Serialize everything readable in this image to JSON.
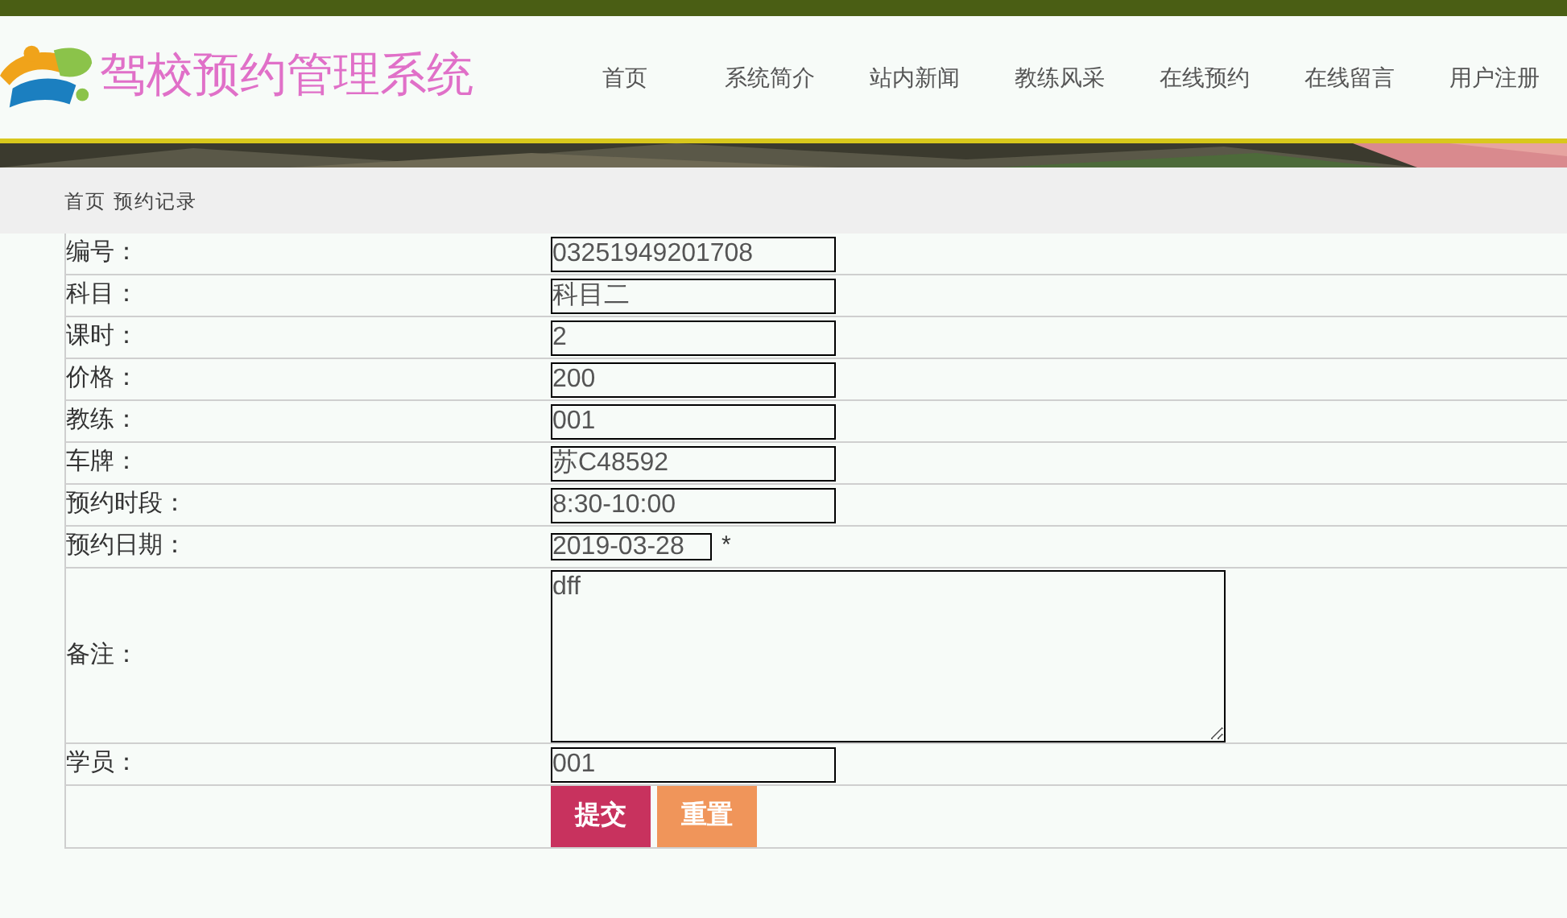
{
  "header": {
    "title": "驾校预约管理系统"
  },
  "nav": [
    {
      "label": "首页"
    },
    {
      "label": "系统简介"
    },
    {
      "label": "站内新闻"
    },
    {
      "label": "教练风采"
    },
    {
      "label": "在线预约"
    },
    {
      "label": "在线留言"
    },
    {
      "label": "用户注册"
    }
  ],
  "breadcrumb": "首页 预约记录",
  "form": {
    "fields": [
      {
        "kind": "input",
        "label": "编号：",
        "value": "03251949201708"
      },
      {
        "kind": "input",
        "label": "科目：",
        "value": "科目二"
      },
      {
        "kind": "input",
        "label": "课时：",
        "value": "2"
      },
      {
        "kind": "input",
        "label": "价格：",
        "value": "200"
      },
      {
        "kind": "input",
        "label": "教练：",
        "value": "001"
      },
      {
        "kind": "input",
        "label": "车牌：",
        "value": "苏C48592"
      },
      {
        "kind": "input",
        "label": "预约时段：",
        "value": "8:30-10:00"
      },
      {
        "kind": "date",
        "label": "预约日期：",
        "value": "2019-03-28",
        "required_mark": "*"
      },
      {
        "kind": "textarea",
        "label": "备注：",
        "value": "dff"
      },
      {
        "kind": "input",
        "label": "学员：",
        "value": "001"
      }
    ],
    "buttons": [
      {
        "kind": "submit",
        "label": "提交"
      },
      {
        "kind": "reset",
        "label": "重置"
      }
    ]
  }
}
